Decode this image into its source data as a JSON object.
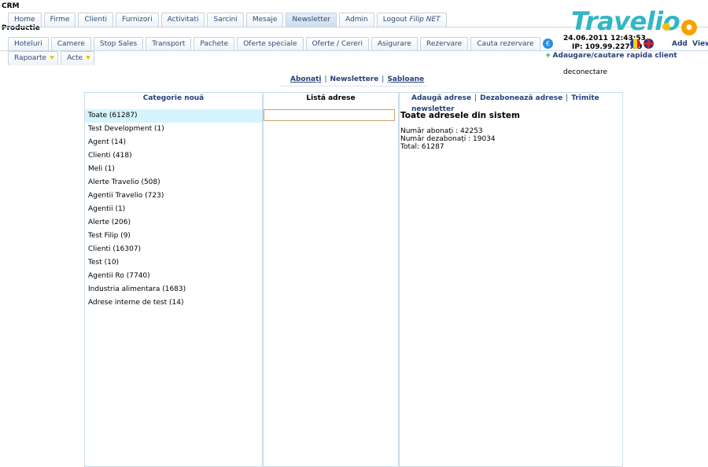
{
  "header": {
    "app": "CRM",
    "environment": "Productie",
    "date_time": "24.06.2011 12:43:53",
    "ip": "IP: 109.99.227.19",
    "add_label": "Add",
    "view_label": "View",
    "quick_add": "Adaugare/cautare rapida client",
    "logout": "deconectare"
  },
  "logo": {
    "text": "Travelio",
    "color": "#31b6c4"
  },
  "tabs_row1": [
    {
      "label": "Home"
    },
    {
      "label": "Firme"
    },
    {
      "label": "Clienti"
    },
    {
      "label": "Furnizori"
    },
    {
      "label": "Activitati"
    },
    {
      "label": "Sarcini"
    },
    {
      "label": "Mesaje"
    },
    {
      "label": "Newsletter",
      "active": true
    },
    {
      "label": "Admin"
    }
  ],
  "logout_tab": {
    "prefix": "Logout ",
    "name": "Filip NET"
  },
  "tabs_row2": [
    {
      "label": "Hoteluri"
    },
    {
      "label": "Camere"
    },
    {
      "label": "Stop Sales"
    },
    {
      "label": "Transport"
    },
    {
      "label": "Pachete"
    },
    {
      "label": "Oferte speciale"
    },
    {
      "label": "Oferte / Cereri"
    },
    {
      "label": "Asigurare"
    },
    {
      "label": "Rezervare"
    },
    {
      "label": "Cauta rezervare"
    }
  ],
  "tabs_row3": [
    {
      "label": "Rapoarte"
    },
    {
      "label": "Acte"
    }
  ],
  "subnav": {
    "subscribers": "Abonați",
    "newsletters": "Newslettere",
    "templates": "Șabloane"
  },
  "panels": {
    "categories": {
      "header": "Categorie nouă",
      "items": [
        "Toate (61287)",
        "Test Development (1)",
        "Agent (14)",
        "Clienti (418)",
        "Meli (1)",
        "Alerte Travelio (508)",
        "Agentii Travelio (723)",
        "Agentii (1)",
        "Alerte (206)",
        "Test Filip (9)",
        "Clienti (16307)",
        "Test (10)",
        "Agentii Ro (7740)",
        "Industria alimentara (1683)",
        "Adrese interne de test (14)"
      ]
    },
    "addresses": {
      "header": "Listă adrese",
      "input_value": ""
    },
    "details": {
      "add": "Adaugă adrese",
      "unsubscribe": "Dezabonează adrese",
      "send": "Trimite newsletter",
      "title": "Toate adresele din sistem",
      "subscribed": "Număr abonați : 42253",
      "unsubscribed": "Număr dezabonați : 19034",
      "total": "Total: 61287"
    }
  }
}
